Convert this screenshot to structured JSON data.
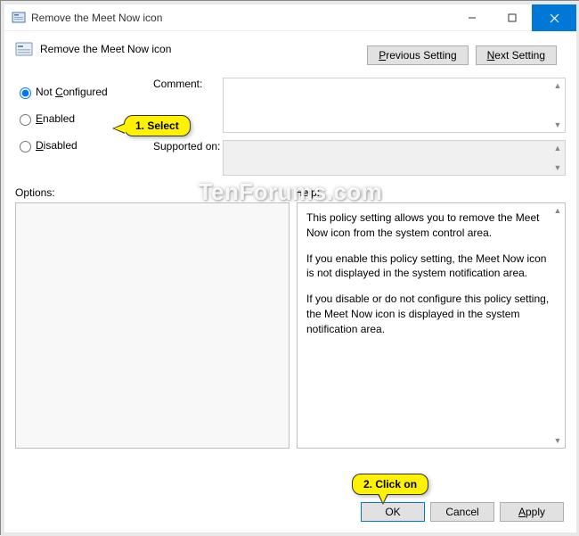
{
  "window": {
    "title": "Remove the Meet Now icon"
  },
  "header": {
    "policy_title": "Remove the Meet Now icon",
    "previous_label": "Previous Setting",
    "next_label": "Next Setting"
  },
  "state": {
    "not_configured": "Not Configured",
    "enabled": "Enabled",
    "disabled": "Disabled",
    "selected": "not_configured"
  },
  "labels": {
    "comment": "Comment:",
    "supported_on": "Supported on:",
    "options": "Options:",
    "help": "Help:"
  },
  "fields": {
    "comment_value": "",
    "supported_value": ""
  },
  "help": {
    "p1": "This policy setting allows you to remove the Meet Now icon from the system control area.",
    "p2": "If you enable this policy setting, the Meet Now icon is not displayed in the system notification area.",
    "p3": "If you disable or do not configure this policy setting, the Meet Now icon is displayed in the system notification area."
  },
  "footer": {
    "ok": "OK",
    "cancel": "Cancel",
    "apply": "Apply"
  },
  "callouts": {
    "c1": "1. Select",
    "c2": "2. Click on"
  },
  "watermark": "TenForums.com"
}
